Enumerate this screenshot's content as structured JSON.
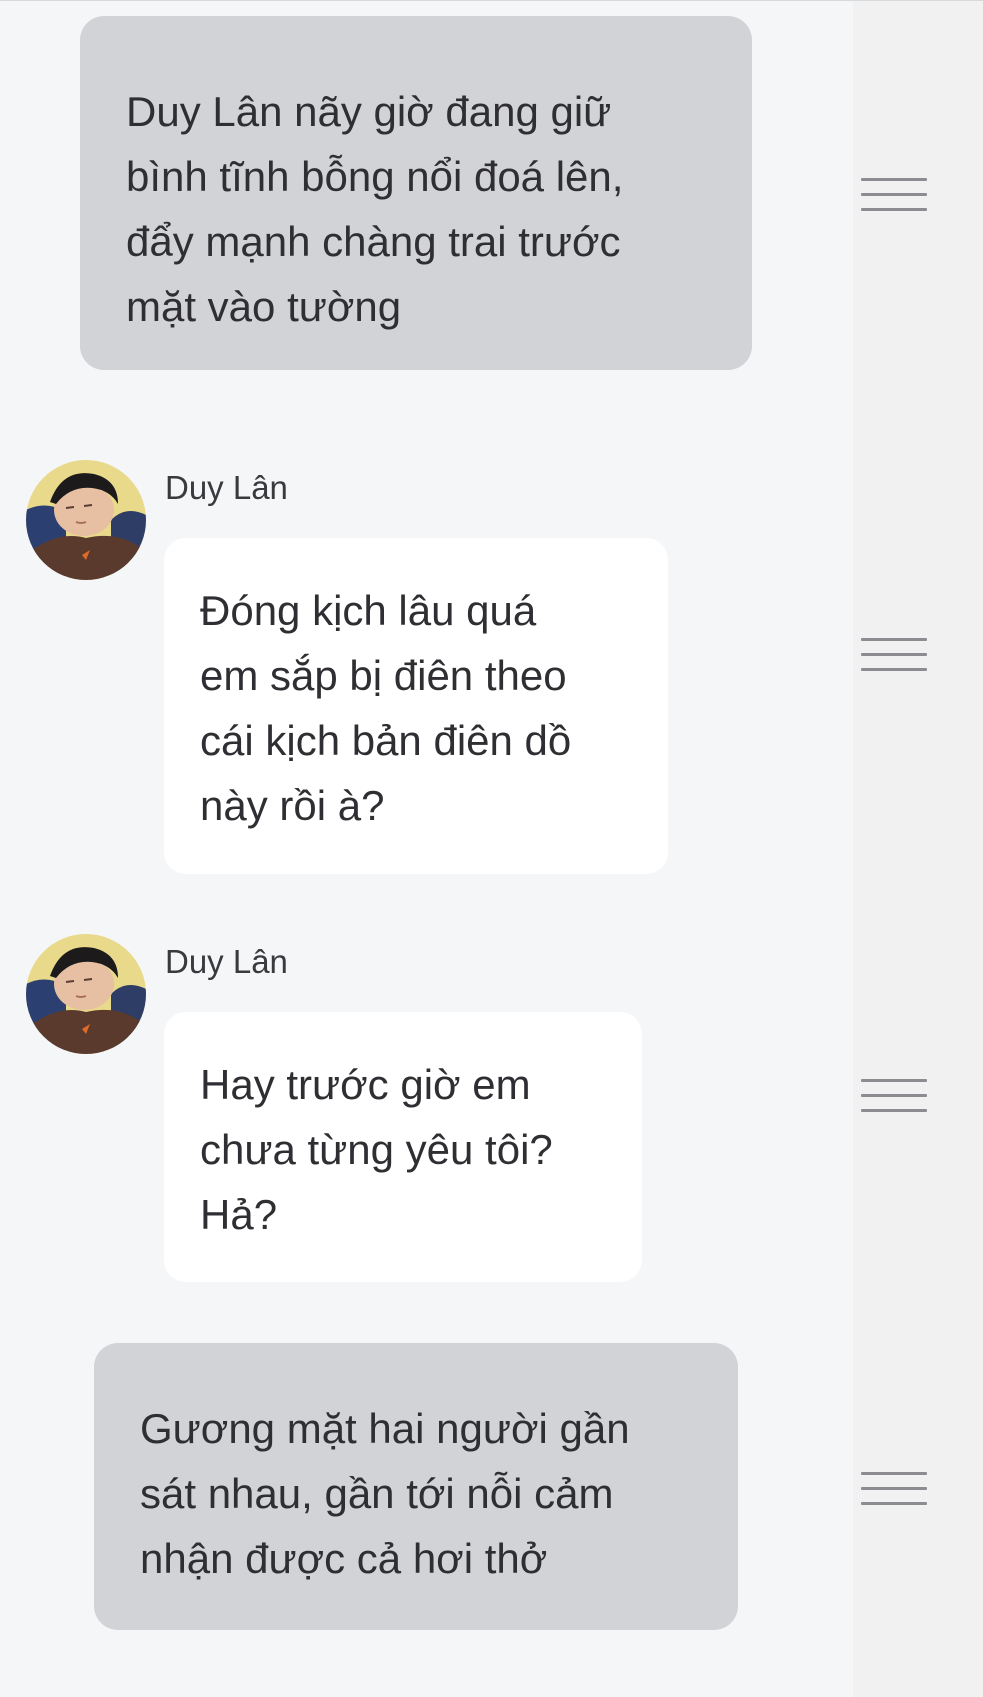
{
  "messages": [
    {
      "type": "narration",
      "text": "Duy Lân nãy giờ đang giữ\nbình tĩnh bỗng nổi đoá lên,\nđẩy mạnh chàng trai trước\nmặt vào tường"
    },
    {
      "type": "speech",
      "speaker": "Duy Lân",
      "avatar_icon": "sleeping-boy-avatar",
      "text": "Đóng kịch lâu quá\nem sắp bị điên theo\ncái kịch bản điên dồ\nnày rồi à?"
    },
    {
      "type": "speech",
      "speaker": "Duy Lân",
      "avatar_icon": "sleeping-boy-avatar",
      "text": "Hay trước giờ em\nchưa từng yêu tôi?\nHả?"
    },
    {
      "type": "narration",
      "text": "Gương mặt hai người gần\nsát nhau, gần tới nỗi cảm\nnhận được cả hơi thở"
    }
  ],
  "menu_icon": "hamburger-menu-icon",
  "colors": {
    "background": "#f5f6f8",
    "narration_bubble": "#d2d3d6",
    "speech_bubble": "#ffffff",
    "text": "#2f2f33",
    "menu_lines": "#8c8d90"
  }
}
